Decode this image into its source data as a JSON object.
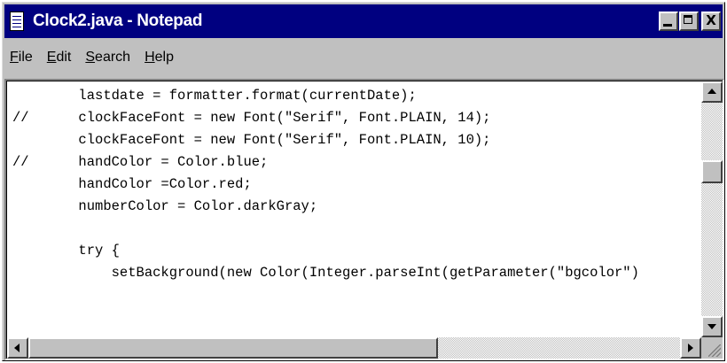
{
  "window": {
    "title": "Clock2.java - Notepad",
    "icon": "notepad-icon",
    "controls": {
      "minimize": "minimize-icon",
      "maximize": "maximize-icon",
      "close": "close-icon",
      "close_glyph": "X"
    }
  },
  "menu": {
    "items": [
      {
        "mnemonic": "F",
        "rest": "ile"
      },
      {
        "mnemonic": "E",
        "rest": "dit"
      },
      {
        "mnemonic": "S",
        "rest": "earch"
      },
      {
        "mnemonic": "H",
        "rest": "elp"
      }
    ]
  },
  "editor": {
    "lines": [
      "        lastdate = formatter.format(currentDate);",
      "//      clockFaceFont = new Font(\"Serif\", Font.PLAIN, 14);",
      "        clockFaceFont = new Font(\"Serif\", Font.PLAIN, 10);",
      "//      handColor = Color.blue;",
      "        handColor =Color.red;",
      "        numberColor = Color.darkGray;",
      "",
      "        try {",
      "            setBackground(new Color(Integer.parseInt(getParameter(\"bgcolor\")"
    ]
  },
  "scrollbars": {
    "vertical_position": 0.3,
    "horizontal_position": 0.0
  },
  "colors": {
    "titlebar": "#000080",
    "face": "#c0c0c0",
    "editor_background": "#ffffff",
    "text": "#000000"
  }
}
